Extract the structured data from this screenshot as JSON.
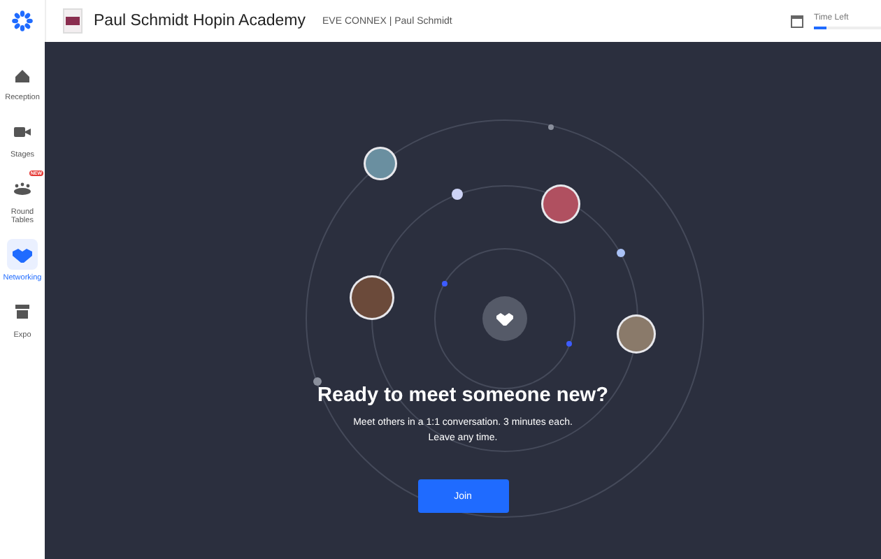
{
  "header": {
    "title": "Paul Schmidt Hopin Academy",
    "subtitle": "EVE CONNEX | Paul Schmidt",
    "timer": {
      "label": "Time Left",
      "level": 0.18
    }
  },
  "sidebar": {
    "items": [
      {
        "kind": "home",
        "label": "Reception",
        "selected": false
      },
      {
        "kind": "video",
        "label": "Stages",
        "selected": false
      },
      {
        "kind": "table",
        "label": "Round Tables",
        "selected": false,
        "badge": "NEW"
      },
      {
        "kind": "handshake",
        "label": "Networking",
        "selected": true
      },
      {
        "kind": "booth",
        "label": "Expo",
        "selected": false
      }
    ]
  },
  "networking": {
    "heading": "Ready to meet someone new?",
    "description": "Meet others in a 1:1 conversation. 3 minutes each.\nLeave any time.",
    "button": "Join"
  }
}
